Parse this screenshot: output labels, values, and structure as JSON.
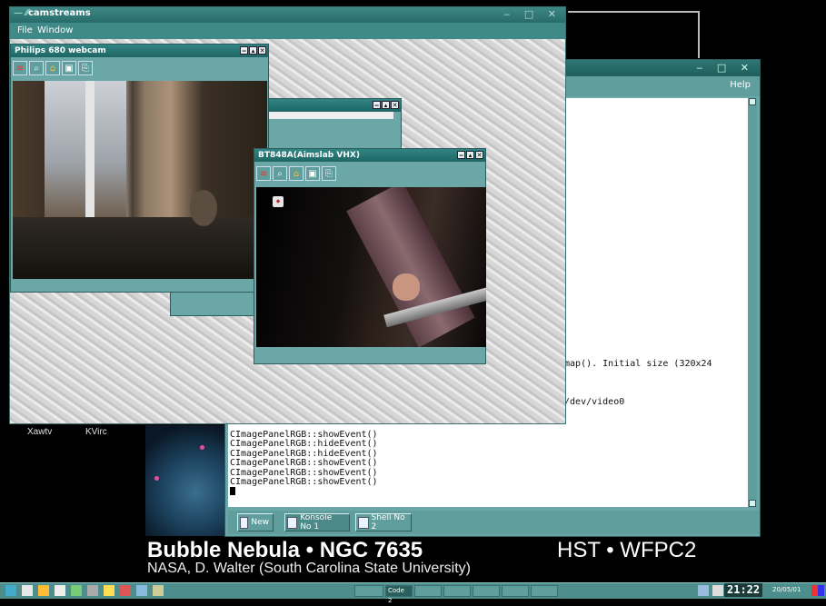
{
  "desktop": {
    "icons": [
      "Xawtv",
      "KVirc"
    ],
    "wallpaper": {
      "title": "Bubble Nebula • NGC 7635",
      "hst": "HST • WFPC2",
      "credit": "NASA, D. Walter (South Carolina State University)"
    }
  },
  "konsole": {
    "menu_help": "Help",
    "visible_text": [
      "mmap(). Initial size (320x24",
      ":/dev/video0"
    ],
    "lines": [
      "CImagePanelRGB::showEvent()",
      "CImagePanelRGB::hideEvent()",
      "CImagePanelRGB::hideEvent()",
      "CImagePanelRGB::showEvent()",
      "CImagePanelRGB::showEvent()",
      "CImagePanelRGB::showEvent()"
    ],
    "tabs": [
      {
        "label": "New",
        "icon": "new-session-icon"
      },
      {
        "label": "Konsole No 1",
        "icon": "terminal-icon"
      },
      {
        "label": "Shell No 2",
        "icon": "terminal-icon"
      }
    ]
  },
  "camstreams": {
    "title": "camstreams",
    "menu": [
      "File",
      "Window"
    ],
    "webcam_window": {
      "title": "Philips 680 webcam",
      "toolbar_icons": [
        "color-bars-icon",
        "magnifier-icon",
        "home-icon",
        "save-icon",
        "snapshot-icon"
      ]
    },
    "tv_window": {
      "title": "BT848A(Aimslab VHX)",
      "toolbar_icons": [
        "color-bars-icon",
        "magnifier-icon",
        "home-icon",
        "save-icon",
        "snapshot-icon"
      ]
    }
  },
  "taskbar": {
    "tasks": [
      "",
      "Code 2",
      "",
      "",
      "",
      "",
      ""
    ],
    "clock": "21:22",
    "date": "20/05/01"
  },
  "colors": {
    "teal": "#6aa7a6",
    "title_teal": "#2f7674"
  }
}
